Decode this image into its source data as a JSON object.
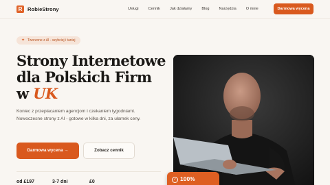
{
  "nav": {
    "logo_icon": "R",
    "logo_text": "RobieStrony",
    "links": [
      "Usługi",
      "Cennik",
      "Jak działamy",
      "Blog",
      "Narzędzia",
      "O mnie"
    ],
    "cta": "Darmowa wycena"
  },
  "hero": {
    "pill_icon": "✦",
    "pill_text": "Tworzone z AI - szybciej i taniej",
    "headline_line1": "Strony Internetowe",
    "headline_line2": "dla Polskich Firm",
    "headline_line3_prefix": "w ",
    "headline_accent": "UK",
    "subtitle": "Koniec z przepłacaniem agencjom i czekaniem tygodniami. Nowoczesne strony z AI - gotowe w kilka dni, za ułamek ceny.",
    "primary_button": "Darmowa wycena →",
    "secondary_button": "Zobacz cennik"
  },
  "stats": [
    "od £197",
    "3-7 dni",
    "£0"
  ],
  "badge": {
    "icon": "check-circle-icon",
    "text": "100%"
  },
  "colors": {
    "accent": "#d9591e",
    "background": "#f9f6f2",
    "text": "#1d1b19"
  }
}
